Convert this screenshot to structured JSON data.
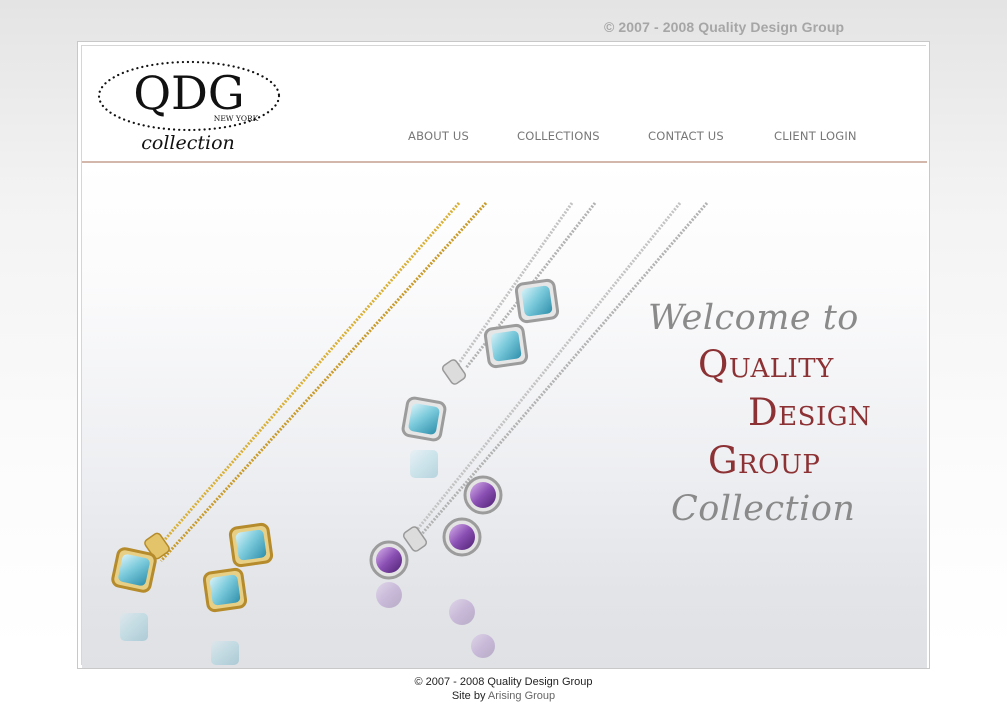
{
  "top_copyright": "© 2007 - 2008 Quality Design Group",
  "logo": {
    "letters": "QDG",
    "location": "NEW YORK",
    "word": "collection"
  },
  "nav": {
    "items": [
      {
        "label": "ABOUT US"
      },
      {
        "label": "COLLECTIONS"
      },
      {
        "label": "CONTACT US"
      },
      {
        "label": "CLIENT LOGIN"
      }
    ]
  },
  "hero": {
    "line1": "Welcome to",
    "line2": "Quality",
    "line3": "Design",
    "line4": "Group",
    "line5": "Collection"
  },
  "footer": {
    "copyright": "© 2007 - 2008 Quality Design Group",
    "credit_prefix": "Site by ",
    "credit_link": "Arising Group"
  },
  "colors": {
    "brand_red": "#8c3134",
    "nav_gray": "#777777",
    "header_rule": "#d2b7aa",
    "topaz": "#7ccbdc",
    "amethyst": "#8a4fb3",
    "gold": "#d9b036",
    "silver": "#c3c3c3"
  }
}
